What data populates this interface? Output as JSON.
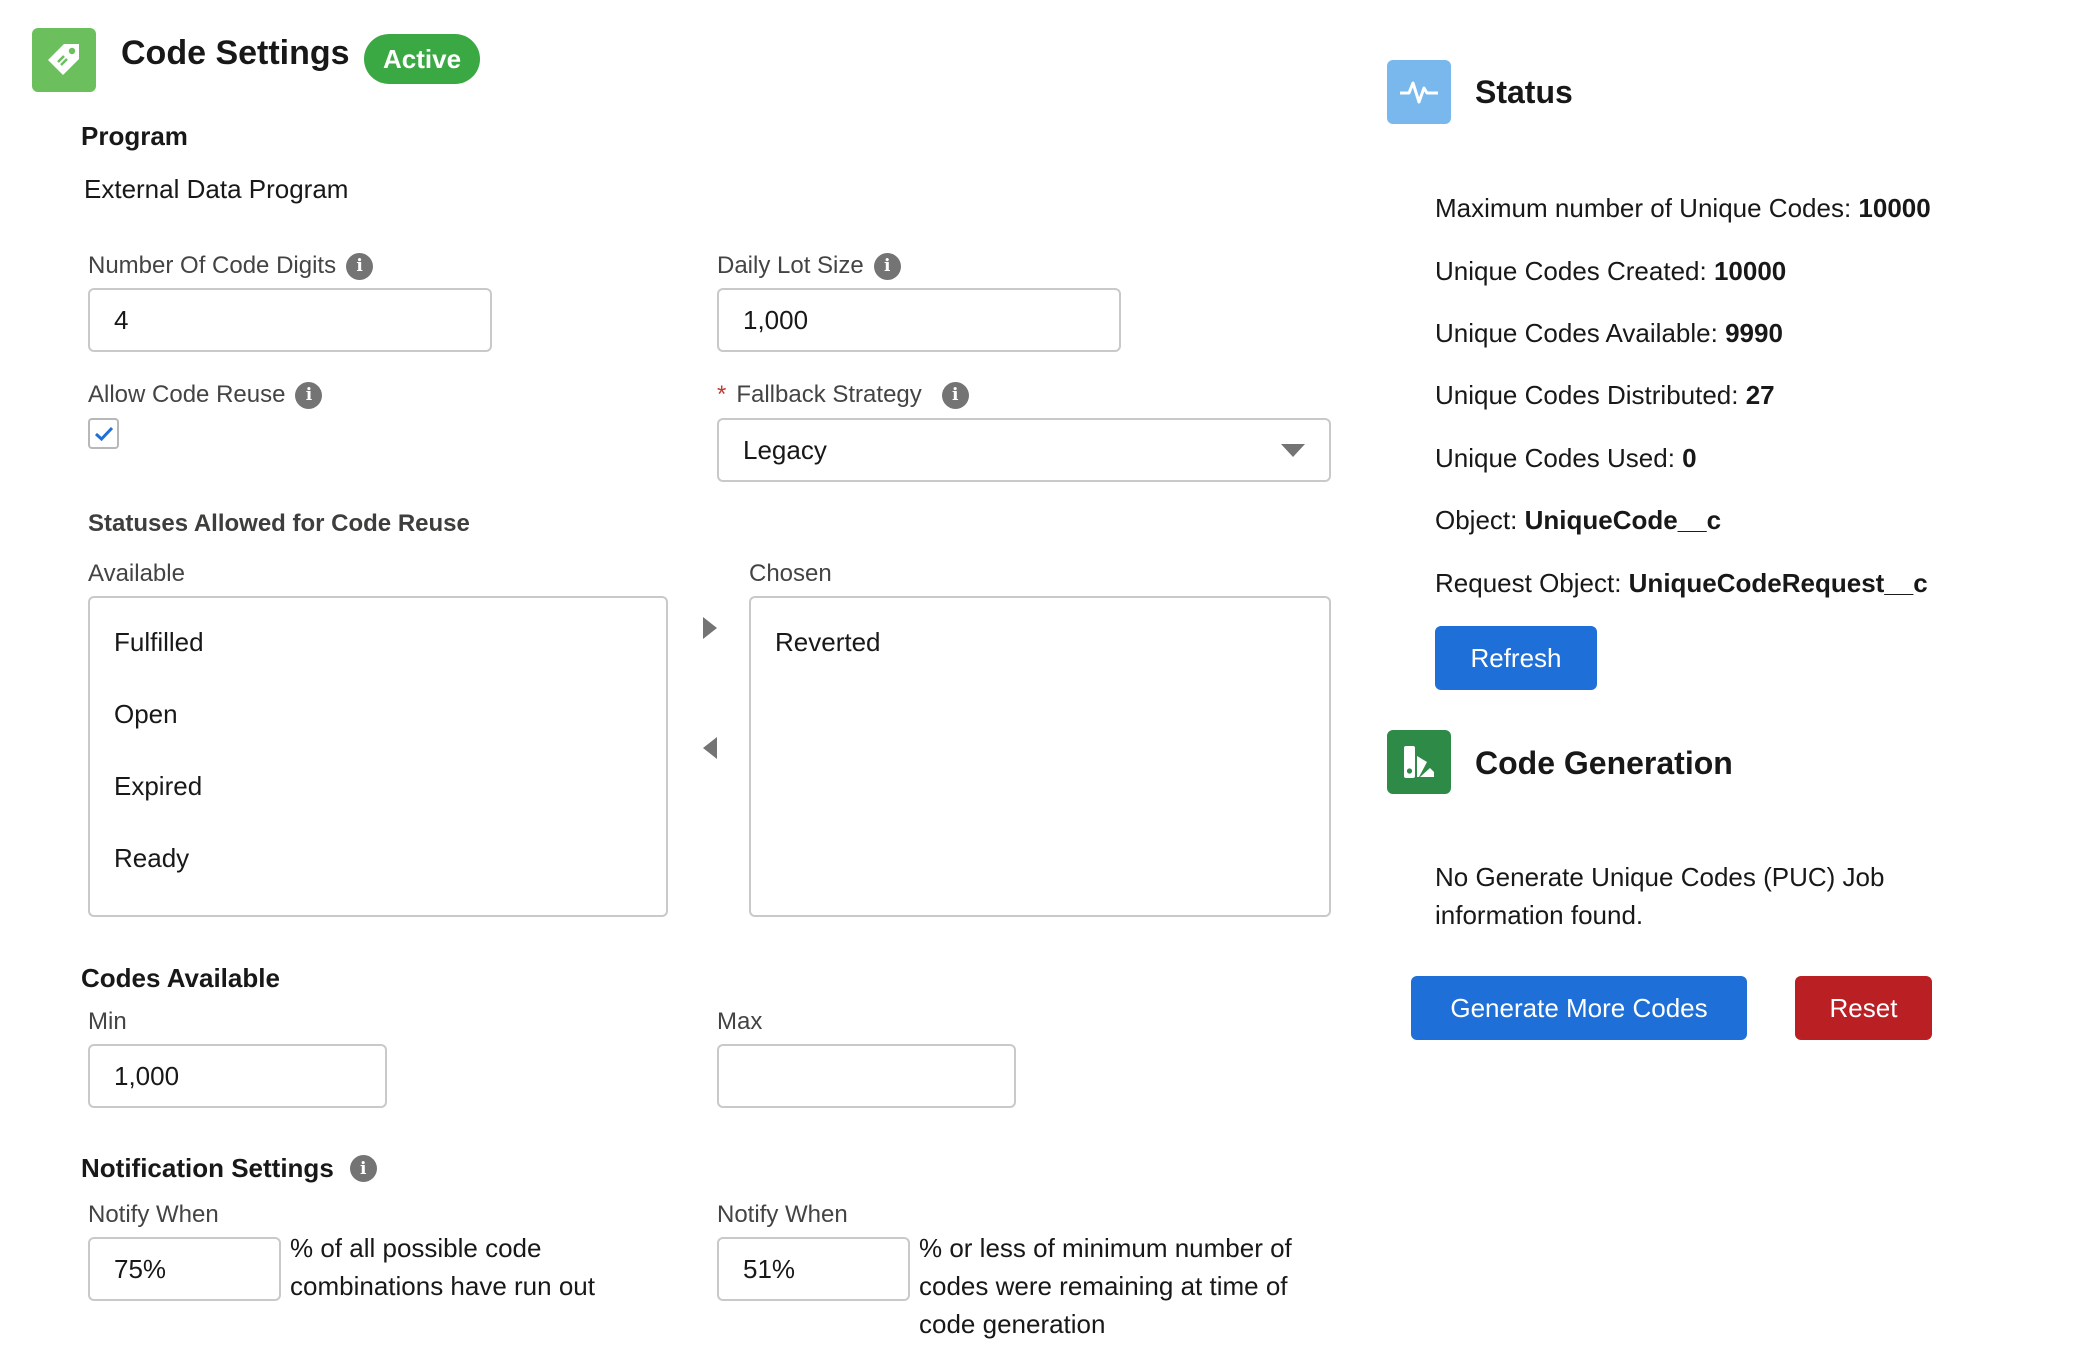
{
  "header": {
    "title": "Code Settings",
    "badge": "Active"
  },
  "program": {
    "label": "Program",
    "value": "External Data Program"
  },
  "fields": {
    "code_digits": {
      "label": "Number Of Code Digits",
      "value": "4"
    },
    "daily_lot": {
      "label": "Daily Lot Size",
      "value": "1,000"
    },
    "allow_reuse": {
      "label": "Allow Code Reuse",
      "checked": true
    },
    "fallback": {
      "label": "Fallback Strategy",
      "required_mark": "*",
      "value": "Legacy"
    }
  },
  "statuses": {
    "title": "Statuses Allowed for Code Reuse",
    "available_label": "Available",
    "chosen_label": "Chosen",
    "available": [
      "Fulfilled",
      "Open",
      "Expired",
      "Ready"
    ],
    "chosen": [
      "Reverted"
    ]
  },
  "codes_available": {
    "title": "Codes Available",
    "min_label": "Min",
    "min_value": "1,000",
    "max_label": "Max",
    "max_value": ""
  },
  "notifications": {
    "title": "Notification Settings",
    "left": {
      "label": "Notify When",
      "value": "75%",
      "desc_line1": "% of all possible code",
      "desc_line2": "combinations have run out"
    },
    "right": {
      "label": "Notify When",
      "value": "51%",
      "desc_line1": "% or less of minimum number of",
      "desc_line2": "codes were remaining at time of",
      "desc_line3": "code generation"
    }
  },
  "status_panel": {
    "title": "Status",
    "lines": [
      {
        "label": "Maximum number of Unique Codes: ",
        "value": "10000"
      },
      {
        "label": "Unique Codes Created: ",
        "value": "10000"
      },
      {
        "label": "Unique Codes Available: ",
        "value": "9990"
      },
      {
        "label": "Unique Codes Distributed: ",
        "value": "27"
      },
      {
        "label": "Unique Codes Used: ",
        "value": "0"
      },
      {
        "label": "Object: ",
        "value": "UniqueCode__c"
      },
      {
        "label": "Request Object: ",
        "value": "UniqueCodeRequest__c"
      }
    ],
    "refresh_label": "Refresh"
  },
  "code_generation": {
    "title": "Code Generation",
    "message_line1": "No Generate Unique Codes (PUC) Job",
    "message_line2": "information found.",
    "generate_label": "Generate More Codes",
    "reset_label": "Reset"
  },
  "colors": {
    "app_icon": "#6bbf5c",
    "badge": "#3aa843",
    "status_icon": "#78b8ec",
    "codegen_icon": "#2e8a47",
    "primary": "#1f6fd8",
    "destructive": "#ba1f24"
  },
  "icons": {
    "app": "tag-icon",
    "status": "pulse-icon",
    "codegen": "swatch-icon",
    "info": "info-icon"
  }
}
